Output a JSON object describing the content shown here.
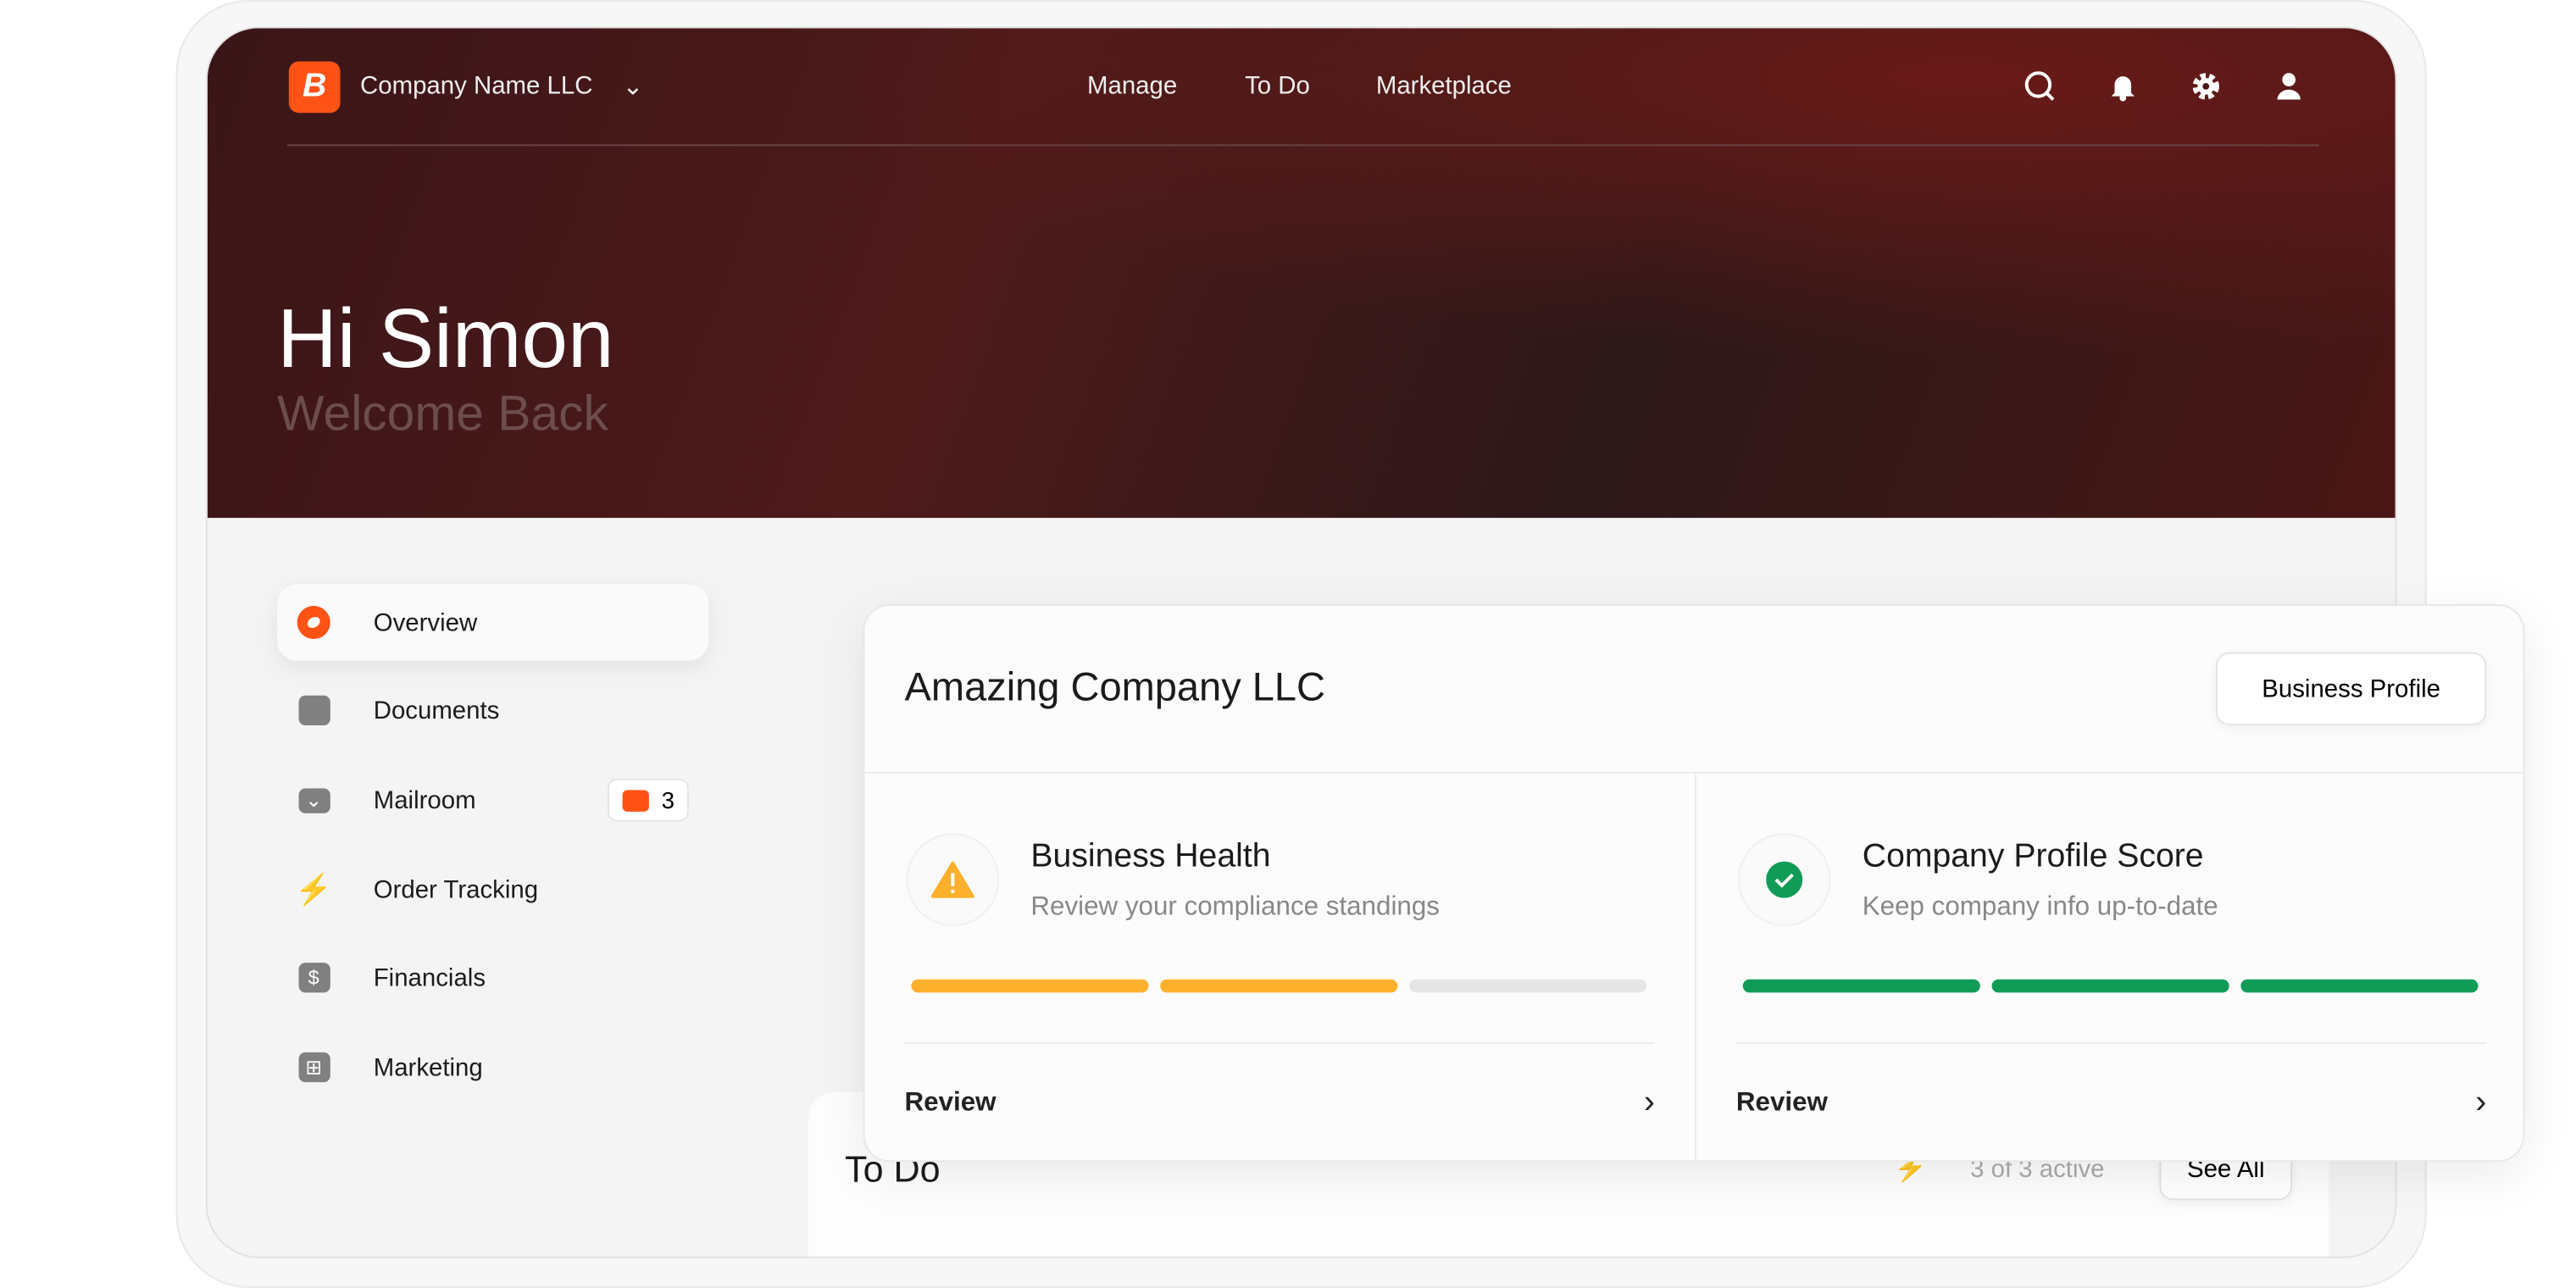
{
  "header": {
    "company": "Company Name LLC",
    "nav": [
      "Manage",
      "To Do",
      "Marketplace"
    ],
    "icons": [
      "search-icon",
      "bell-icon",
      "gear-icon",
      "user-icon"
    ]
  },
  "hero": {
    "greeting": "Hi Simon",
    "subtitle": "Welcome Back"
  },
  "sidebar": {
    "items": [
      {
        "label": "Overview",
        "icon": "overview-icon",
        "active": true
      },
      {
        "label": "Documents",
        "icon": "document-icon"
      },
      {
        "label": "Mailroom",
        "icon": "mail-icon",
        "badge": "3"
      },
      {
        "label": "Order Tracking",
        "icon": "lightning-icon"
      },
      {
        "label": "Financials",
        "icon": "dollar-icon"
      },
      {
        "label": "Marketing",
        "icon": "grid-icon"
      }
    ]
  },
  "todo": {
    "title": "To Do",
    "status": "3 of 3 active",
    "see_all": "See All"
  },
  "card": {
    "title": "Amazing Company LLC",
    "profile_button": "Business Profile",
    "sections": [
      {
        "title": "Business Health",
        "subtitle": "Review your compliance standings",
        "progress": "2 of 3",
        "color": "#FFB12E",
        "action": "Review",
        "icon": "warning-icon"
      },
      {
        "title": "Company Profile Score",
        "subtitle": "Keep company info up-to-date",
        "progress": "3 of 3",
        "color": "#109C57",
        "action": "Review",
        "icon": "check-icon"
      }
    ]
  },
  "colors": {
    "brand": "#FF5316",
    "warning": "#FFB12E",
    "success": "#109C57",
    "track": "#E6E6E6"
  }
}
